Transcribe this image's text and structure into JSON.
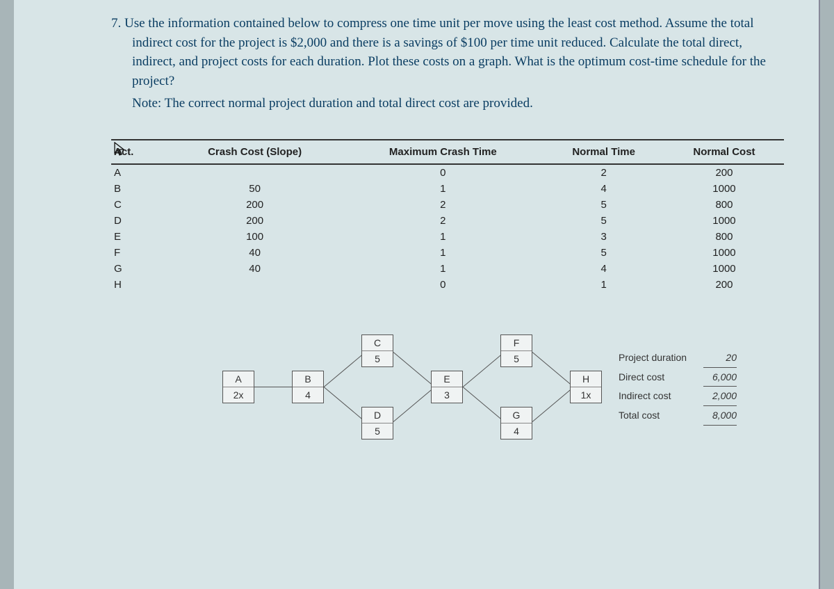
{
  "question": {
    "number": "7.",
    "text": "Use the information contained below to compress one time unit per move using the least cost method. Assume the total indirect cost for the project is $2,000 and there is a savings of $100 per time unit reduced. Calculate the total direct, indirect, and project costs for each duration. Plot these costs on a graph. What is the optimum cost-time schedule for the project?",
    "note_label": "Note:",
    "note_text": "The correct normal project duration and total direct cost are provided."
  },
  "table": {
    "headers": [
      "Act.",
      "Crash Cost (Slope)",
      "Maximum Crash Time",
      "Normal Time",
      "Normal Cost"
    ],
    "rows": [
      [
        "A",
        "",
        "0",
        "2",
        "200"
      ],
      [
        "B",
        "50",
        "1",
        "4",
        "1000"
      ],
      [
        "C",
        "200",
        "2",
        "5",
        "800"
      ],
      [
        "D",
        "200",
        "2",
        "5",
        "1000"
      ],
      [
        "E",
        "100",
        "1",
        "3",
        "800"
      ],
      [
        "F",
        "40",
        "1",
        "5",
        "1000"
      ],
      [
        "G",
        "40",
        "1",
        "4",
        "1000"
      ],
      [
        "H",
        "",
        "0",
        "1",
        "200"
      ]
    ]
  },
  "nodes": {
    "A": {
      "label": "A",
      "value": "2x"
    },
    "B": {
      "label": "B",
      "value": "4"
    },
    "C": {
      "label": "C",
      "value": "5"
    },
    "D": {
      "label": "D",
      "value": "5"
    },
    "E": {
      "label": "E",
      "value": "3"
    },
    "F": {
      "label": "F",
      "value": "5"
    },
    "G": {
      "label": "G",
      "value": "4"
    },
    "H": {
      "label": "H",
      "value": "1x"
    }
  },
  "summary": {
    "duration_label": "Project duration",
    "duration_value": "20",
    "direct_label": "Direct cost",
    "direct_value": "6,000",
    "indirect_label": "Indirect cost",
    "indirect_value": "2,000",
    "total_label": "Total cost",
    "total_value": "8,000"
  },
  "chart_data": {
    "type": "table",
    "title": "Activity crash data and network diagram for least-cost time compression",
    "activities": [
      {
        "act": "A",
        "crash_cost_slope": null,
        "max_crash_time": 0,
        "normal_time": 2,
        "normal_cost": 200
      },
      {
        "act": "B",
        "crash_cost_slope": 50,
        "max_crash_time": 1,
        "normal_time": 4,
        "normal_cost": 1000
      },
      {
        "act": "C",
        "crash_cost_slope": 200,
        "max_crash_time": 2,
        "normal_time": 5,
        "normal_cost": 800
      },
      {
        "act": "D",
        "crash_cost_slope": 200,
        "max_crash_time": 2,
        "normal_time": 5,
        "normal_cost": 1000
      },
      {
        "act": "E",
        "crash_cost_slope": 100,
        "max_crash_time": 1,
        "normal_time": 3,
        "normal_cost": 800
      },
      {
        "act": "F",
        "crash_cost_slope": 40,
        "max_crash_time": 1,
        "normal_time": 5,
        "normal_cost": 1000
      },
      {
        "act": "G",
        "crash_cost_slope": 40,
        "max_crash_time": 1,
        "normal_time": 4,
        "normal_cost": 1000
      },
      {
        "act": "H",
        "crash_cost_slope": null,
        "max_crash_time": 0,
        "normal_time": 1,
        "normal_cost": 200
      }
    ],
    "network_edges": [
      [
        "A",
        "B"
      ],
      [
        "B",
        "C"
      ],
      [
        "B",
        "D"
      ],
      [
        "C",
        "E"
      ],
      [
        "D",
        "E"
      ],
      [
        "E",
        "F"
      ],
      [
        "E",
        "G"
      ],
      [
        "F",
        "H"
      ],
      [
        "G",
        "H"
      ]
    ],
    "project_duration": 20,
    "direct_cost": 6000,
    "indirect_cost": 2000,
    "total_cost": 8000
  }
}
